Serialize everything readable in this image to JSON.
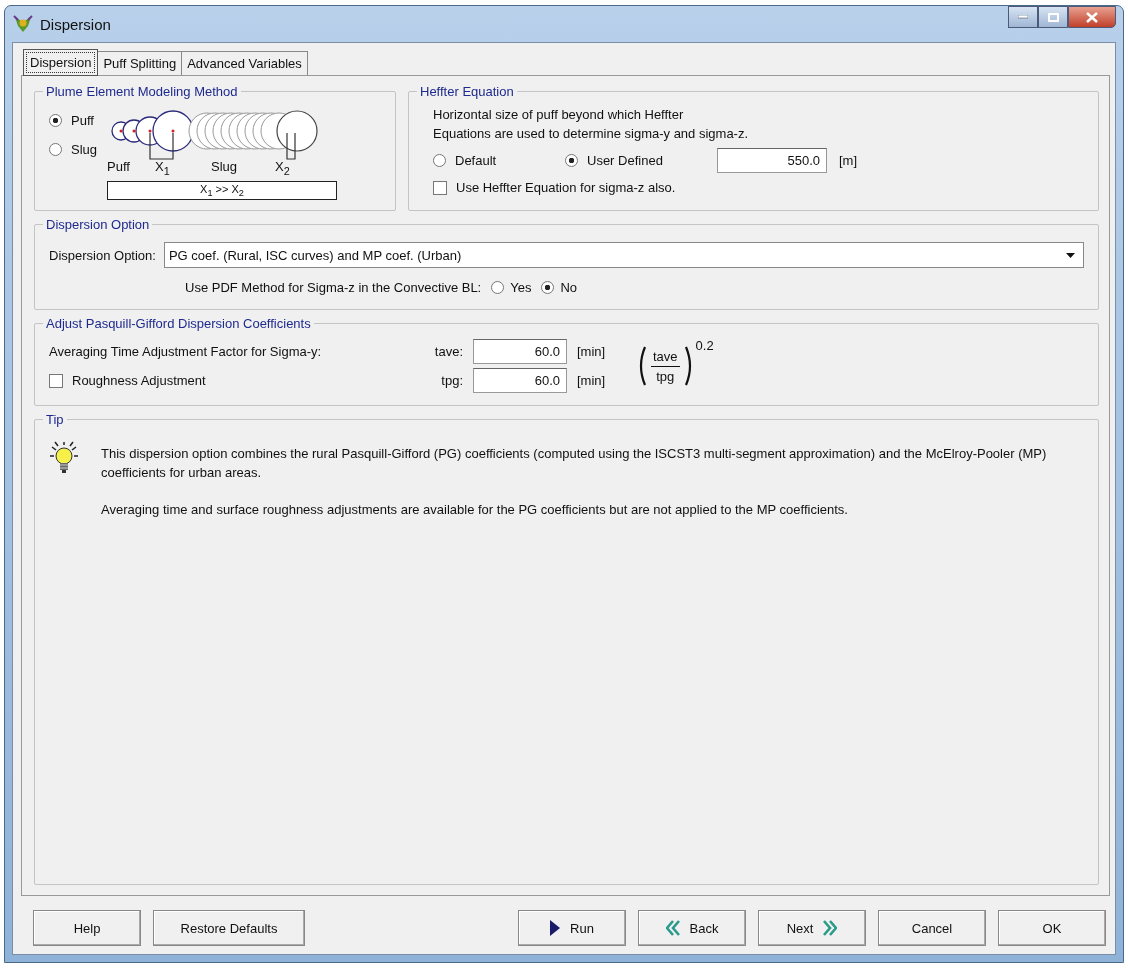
{
  "window": {
    "title": "Dispersion"
  },
  "tabs": [
    {
      "label": "Dispersion",
      "selected": true
    },
    {
      "label": "Puff Splitting",
      "selected": false
    },
    {
      "label": "Advanced Variables",
      "selected": false
    }
  ],
  "plume_method": {
    "title": "Plume Element Modeling Method",
    "options": [
      {
        "label": "Puff",
        "selected": true
      },
      {
        "label": "Slug",
        "selected": false
      }
    ],
    "diagram": {
      "puff_label": "Puff",
      "x1_label": "X$_{1}$",
      "slug_label": "Slug",
      "x2_label": "X$_{2}$",
      "relation": "X$_{1}$ >> X$_{2}$"
    }
  },
  "heffter": {
    "title": "Heffter Equation",
    "description_lines": [
      "Horizontal size of puff beyond which Heffter",
      "Equations are used to determine sigma-y and sigma-z."
    ],
    "options": [
      {
        "label": "Default",
        "selected": false
      },
      {
        "label": "User Defined",
        "selected": true
      }
    ],
    "value": "550.0",
    "unit": "[m]",
    "sigma_z_checkbox": {
      "label": "Use Heffter Equation for sigma-z also.",
      "checked": false
    }
  },
  "dispersion_option": {
    "title": "Dispersion Option",
    "label": "Dispersion Option:",
    "value": "PG coef. (Rural, ISC curves) and MP coef. (Urban)",
    "pdf_label": "Use PDF Method for Sigma-z in the Convective BL:",
    "pdf_options": [
      {
        "label": "Yes",
        "selected": false
      },
      {
        "label": "No",
        "selected": true
      }
    ]
  },
  "pg_adjust": {
    "title": "Adjust Pasquill-Gifford Dispersion Coefficients",
    "averaging_label": "Averaging Time Adjustment Factor for Sigma-y:",
    "fields": [
      {
        "label": "tave:",
        "value": "60.0",
        "unit": "[min]"
      },
      {
        "label": "tpg:",
        "value": "60.0",
        "unit": "[min]"
      }
    ],
    "roughness": {
      "label": "Roughness Adjustment",
      "checked": false
    },
    "formula": {
      "numerator": "tave",
      "denominator": "tpg",
      "exponent": "0.2"
    }
  },
  "tip": {
    "title": "Tip",
    "paragraphs": [
      "This dispersion option combines the rural Pasquill-Gifford (PG) coefficients (computed using the ISCST3 multi-segment approximation) and the McElroy-Pooler (MP) coefficients for urban areas.",
      "Averaging time and surface roughness adjustments are available for the PG coefficients but are not applied to the MP coefficients."
    ]
  },
  "buttons": [
    {
      "label": "Help",
      "kind": "plain"
    },
    {
      "label": "Restore Defaults",
      "kind": "wide"
    },
    {
      "label": "Run",
      "kind": "run"
    },
    {
      "label": "Back",
      "kind": "back"
    },
    {
      "label": "Next",
      "kind": "next"
    },
    {
      "label": "Cancel",
      "kind": "plain"
    },
    {
      "label": "OK",
      "kind": "plain"
    }
  ]
}
